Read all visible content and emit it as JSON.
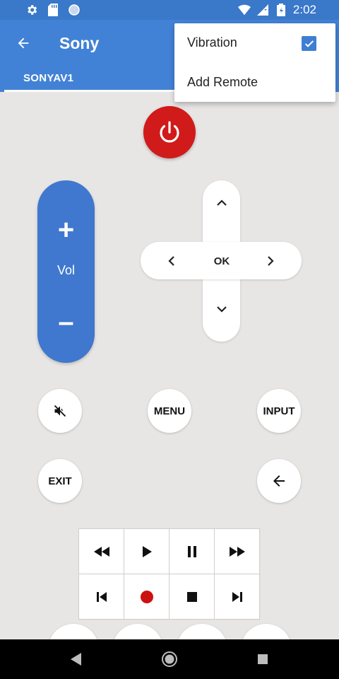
{
  "status_bar": {
    "time": "2:02",
    "icons": [
      "settings-icon",
      "sd-card-icon",
      "circle-icon",
      "wifi-icon",
      "signal-icon",
      "battery-icon"
    ]
  },
  "app_bar": {
    "title": "Sony",
    "back_icon": "arrow-left-icon"
  },
  "tabs": [
    {
      "label": "SONYAV1",
      "selected": true
    }
  ],
  "overflow_menu": {
    "items": [
      {
        "label": "Vibration",
        "checked": true
      },
      {
        "label": "Add Remote"
      }
    ]
  },
  "remote": {
    "power_icon": "power-icon",
    "volume": {
      "plus": "+",
      "label": "Vol",
      "minus": "–"
    },
    "dpad": {
      "ok_label": "OK"
    },
    "buttons": {
      "mute_icon": "mute-icon",
      "menu_label": "MENU",
      "input_label": "INPUT",
      "exit_label": "EXIT",
      "back_icon": "arrow-left-icon"
    },
    "media_controls": [
      "rewind-icon",
      "play-icon",
      "pause-icon",
      "fast-forward-icon",
      "skip-previous-icon",
      "record-icon",
      "stop-icon",
      "skip-next-icon"
    ]
  },
  "colors": {
    "primary": "#4282d6",
    "status_bar": "#3a78c9",
    "power": "#d11a1a",
    "volume": "#3f78ce",
    "background": "#e8e6e5",
    "record": "#cc1111"
  }
}
